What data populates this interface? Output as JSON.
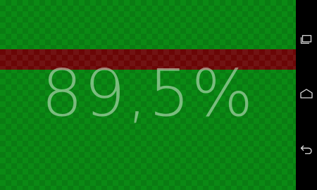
{
  "progress": {
    "percent_text": "89,5%",
    "value": 89.5
  },
  "colors": {
    "background": "#0a8a14",
    "band": "#6a0606",
    "text": "#d2ebd2",
    "navbar": "#000000"
  },
  "navbar": {
    "buttons": [
      {
        "icon": "recent-apps-icon"
      },
      {
        "icon": "home-icon"
      },
      {
        "icon": "back-icon"
      }
    ]
  }
}
